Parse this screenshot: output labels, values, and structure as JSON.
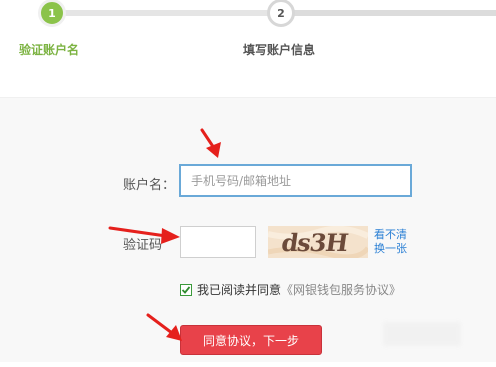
{
  "steps": [
    {
      "number": "1",
      "label": "验证账户名",
      "state": "active"
    },
    {
      "number": "2",
      "label": "填写账户信息",
      "state": "todo"
    }
  ],
  "form": {
    "account_label": "账户名：",
    "account_placeholder": "手机号码/邮箱地址",
    "captcha_label": "验证码",
    "captcha_text": "ds3H",
    "refresh_text": "看不清换一张",
    "agree_text": "我已阅读并同意",
    "agree_link": "《网银钱包服务协议》",
    "agree_checked": true,
    "submit_label": "同意协议，下一步"
  },
  "colors": {
    "step_active": "#8bc34a",
    "link": "#2a7fd4",
    "button": "#e8424a",
    "arrow": "#e5201c"
  },
  "icons": [
    "checkmark-icon",
    "red-arrow-annotation"
  ]
}
